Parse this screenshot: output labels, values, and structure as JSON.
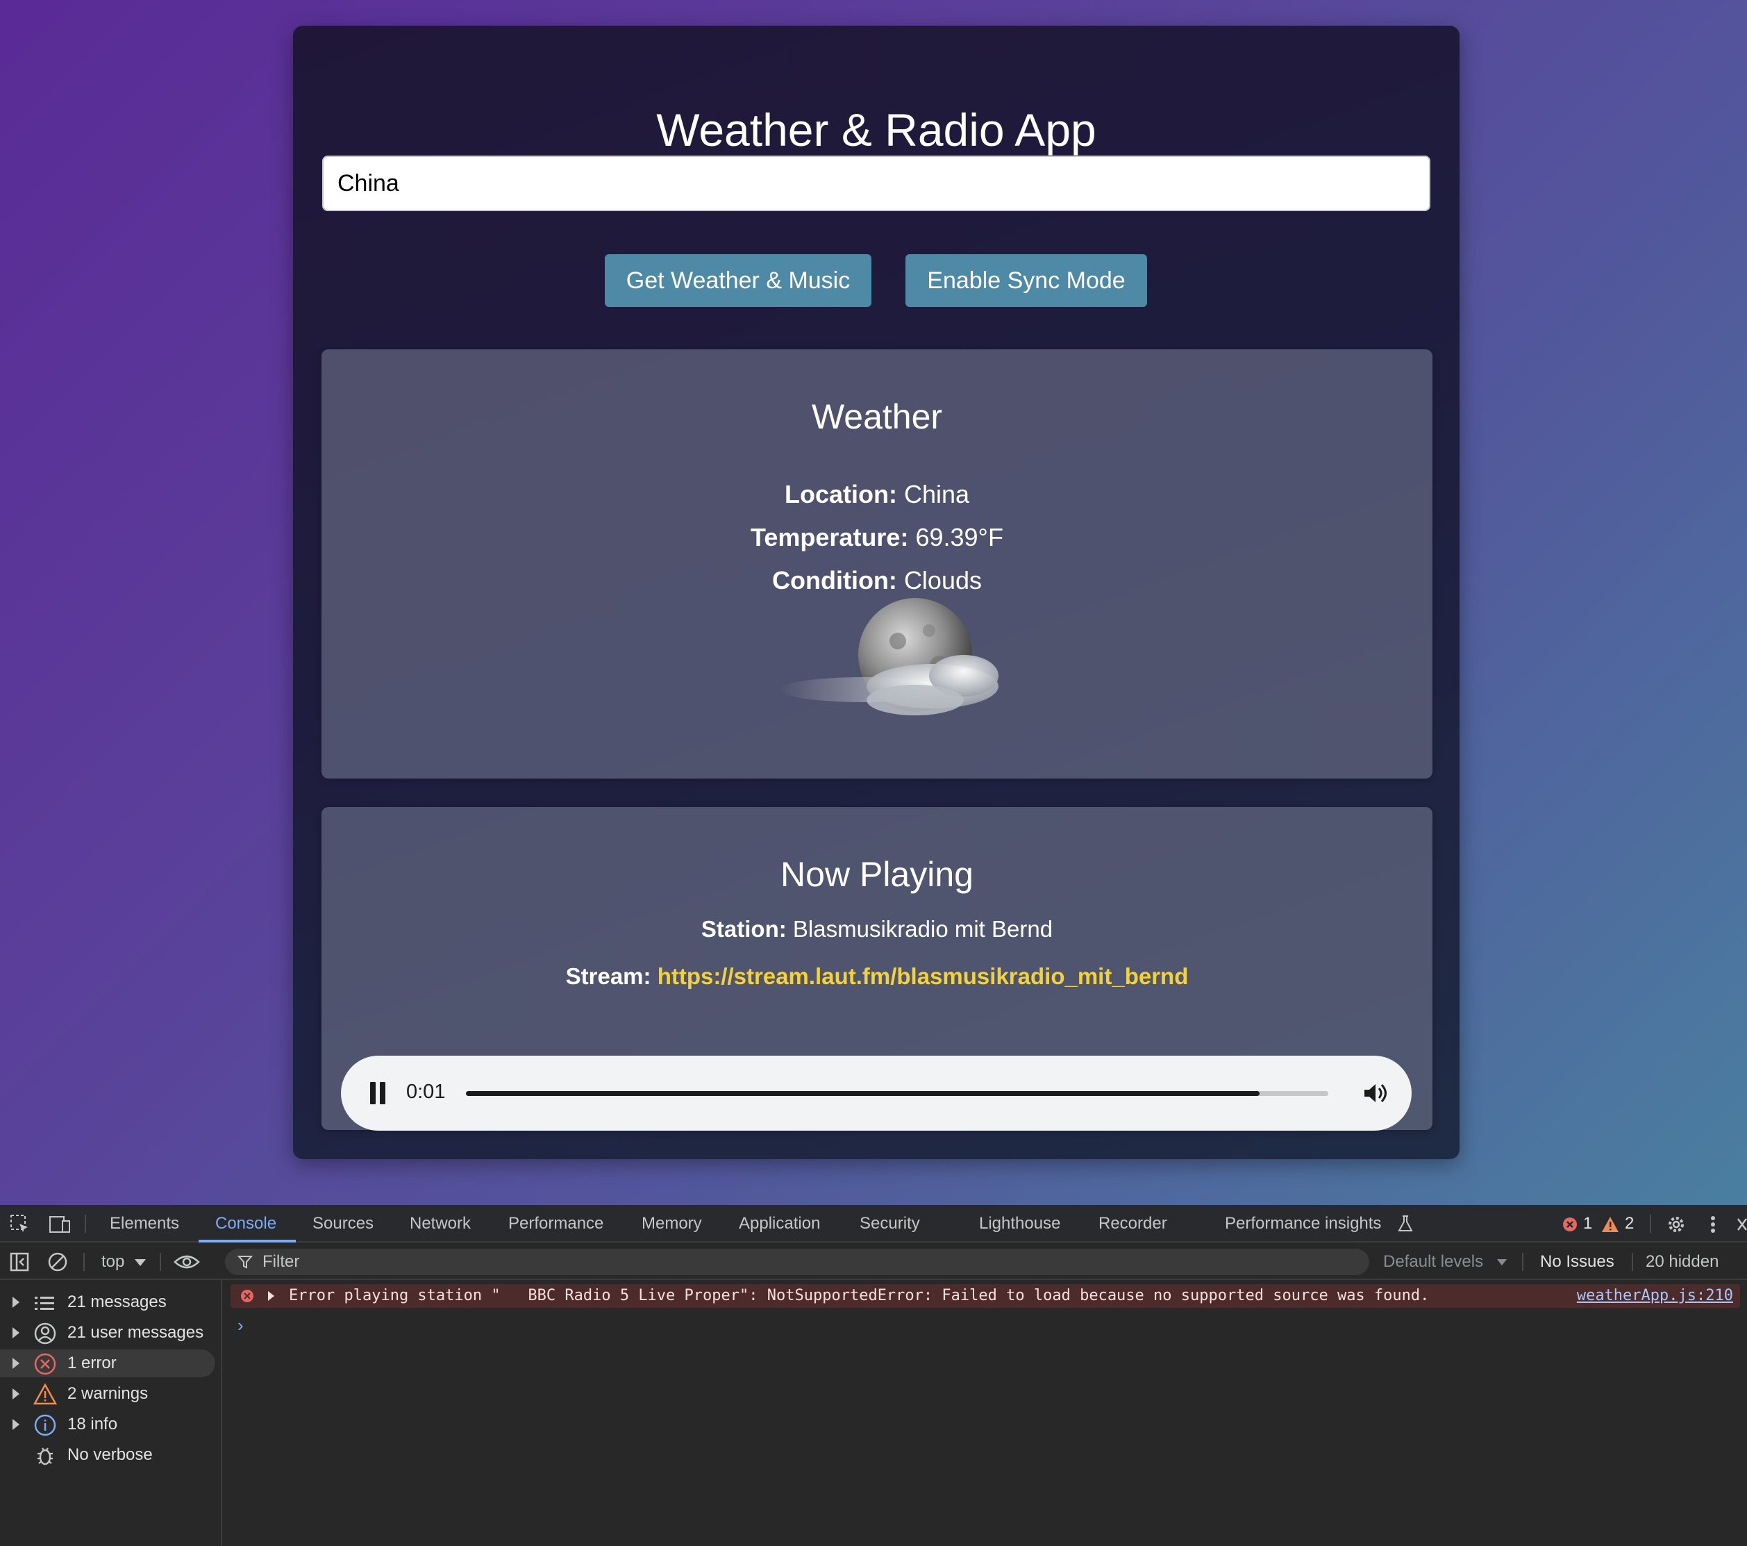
{
  "app": {
    "title": "Weather & Radio App",
    "search_value": "China",
    "buttons": {
      "get": "Get Weather & Music",
      "sync": "Enable Sync Mode"
    },
    "weather": {
      "heading": "Weather",
      "location_label": "Location:",
      "location": "China",
      "temperature_label": "Temperature:",
      "temperature": "69.39°F",
      "condition_label": "Condition:",
      "condition": "Clouds"
    },
    "radio": {
      "heading": "Now Playing",
      "station_label": "Station:",
      "station": "Blasmusikradio mit Bernd",
      "stream_label": "Stream:",
      "stream": "https://stream.laut.fm/blasmusikradio_mit_bernd",
      "player": {
        "time": "0:01",
        "progress": 0.92
      }
    },
    "colors": {
      "button": "#4e8aa5",
      "link": "#f3d23a"
    }
  },
  "devtools": {
    "tabs": [
      "Elements",
      "Console",
      "Sources",
      "Network",
      "Performance",
      "Memory",
      "Application",
      "Security",
      "Lighthouse",
      "Recorder",
      "Performance insights"
    ],
    "active_tab": "Console",
    "error_count": "1",
    "warning_count": "2",
    "toolbar": {
      "context": "top",
      "filter_placeholder": "Filter",
      "levels": "Default levels",
      "issues": "No Issues",
      "hidden": "20 hidden"
    },
    "sidebar": [
      {
        "label": "21 messages",
        "icon": "list-icon"
      },
      {
        "label": "21 user messages",
        "icon": "user-icon"
      },
      {
        "label": "1 error",
        "icon": "error-icon"
      },
      {
        "label": "2 warnings",
        "icon": "warning-icon"
      },
      {
        "label": "18 info",
        "icon": "info-icon"
      },
      {
        "label": "No verbose",
        "icon": "bug-icon"
      }
    ],
    "messages": [
      {
        "text": "Error playing station \"   BBC Radio 5 Live Proper\": NotSupportedError: Failed to load because no supported source was found.",
        "source": "weatherApp.js:210"
      }
    ]
  }
}
